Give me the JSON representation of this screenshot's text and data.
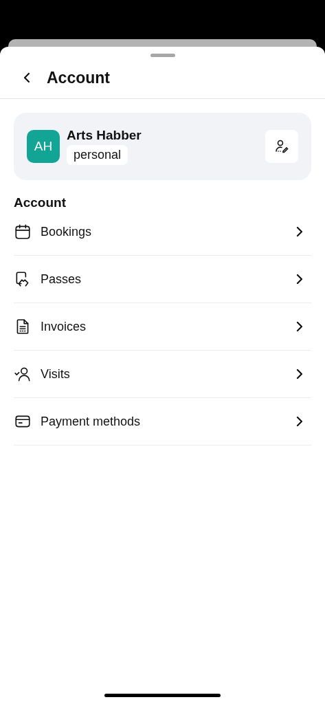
{
  "header": {
    "title": "Account"
  },
  "profile": {
    "initials": "AH",
    "name": "Arts Habber",
    "tag": "personal"
  },
  "section_title": "Account",
  "menu_items": [
    {
      "label": "Bookings"
    },
    {
      "label": "Passes"
    },
    {
      "label": "Invoices"
    },
    {
      "label": "Visits"
    },
    {
      "label": "Payment methods"
    }
  ]
}
